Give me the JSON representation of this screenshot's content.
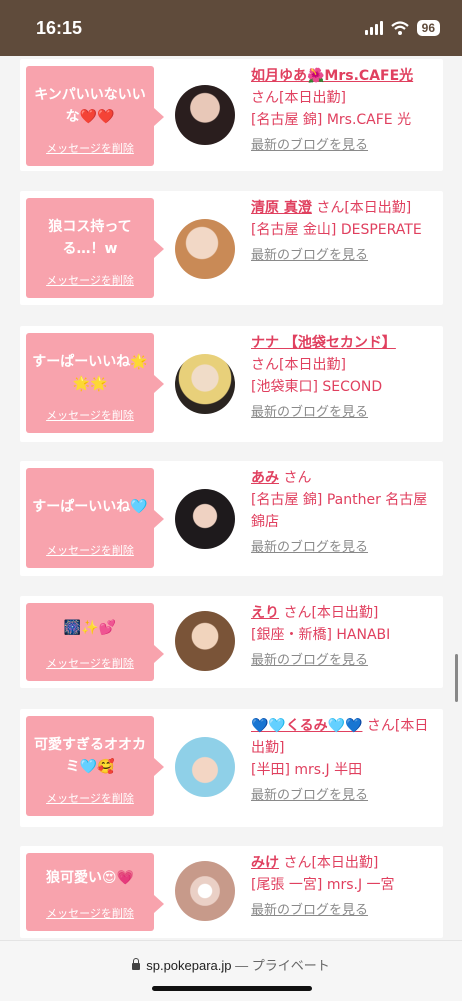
{
  "status": {
    "time": "16:15",
    "battery": "96"
  },
  "browser": {
    "domain": "sp.pokepara.jp",
    "privacy": "— プライベート"
  },
  "cards": [
    {
      "message": "キンパいいないいな❤️❤️",
      "delete": "メッセージを削除",
      "name": "如月ゆあ🌺Mrs.CAFE光",
      "suffix": "さん[本日出勤]",
      "shop": "[名古屋 錦] Mrs.CAFE 光",
      "blog": "最新のブログを見る"
    },
    {
      "message": "狼コス持ってる…！w",
      "delete": "メッセージを削除",
      "name": "清原 真澄",
      "suffix": "さん[本日出勤]",
      "shop": "[名古屋 金山] DESPERATE",
      "blog": "最新のブログを見る"
    },
    {
      "message": "すーぱーいいね🌟🌟🌟",
      "delete": "メッセージを削除",
      "name": "ナナ 【池袋セカンド】",
      "suffix": "さん[本日出勤]",
      "shop": "[池袋東口] SECOND",
      "blog": "最新のブログを見る"
    },
    {
      "message": "すーぱーいいね🩵",
      "delete": "メッセージを削除",
      "name": "あみ",
      "suffix": "さん",
      "shop": "[名古屋 錦] Panther 名古屋錦店",
      "blog": "最新のブログを見る"
    },
    {
      "message": "🎆✨💕",
      "delete": "メッセージを削除",
      "name": "えり",
      "suffix": "さん[本日出勤]",
      "shop": "[銀座・新橋] HANABI",
      "blog": "最新のブログを見る"
    },
    {
      "message": "可愛すぎるオオカミ🩵🥰",
      "delete": "メッセージを削除",
      "name": "💙🩵くるみ🩵💙",
      "suffix": "さん[本日出勤]",
      "shop": "[半田] mrs.J 半田",
      "blog": "最新のブログを見る"
    },
    {
      "message": "狼可愛い😍💗",
      "delete": "メッセージを削除",
      "name": "みけ",
      "suffix": "さん[本日出勤]",
      "shop": "[尾張 一宮] mrs.J 一宮",
      "blog": "最新のブログを見る"
    }
  ]
}
